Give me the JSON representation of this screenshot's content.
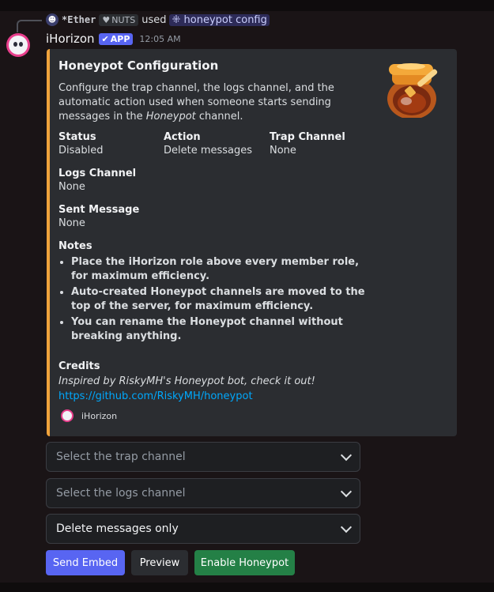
{
  "reply": {
    "user": "*Ether",
    "tag": "NUTS",
    "used": "used",
    "command": "honeypot config"
  },
  "message": {
    "bot_name": "iHorizon",
    "app_badge": "APP",
    "time": "12:05 AM"
  },
  "embed": {
    "accent_color": "#f0a33c",
    "title": "Honeypot Configuration",
    "desc_before": "Configure the trap channel, the logs channel, and the automatic action used when someone starts sending messages in the ",
    "desc_italic": "Honeypot",
    "desc_after": " channel.",
    "thumbnail_icon": "honey-pot-icon",
    "fields": {
      "status": {
        "name": "Status",
        "value": "Disabled"
      },
      "action": {
        "name": "Action",
        "value": "Delete messages"
      },
      "trap": {
        "name": "Trap Channel",
        "value": "None"
      },
      "logs": {
        "name": "Logs Channel",
        "value": "None"
      },
      "sent": {
        "name": "Sent Message",
        "value": "None"
      }
    },
    "notes": {
      "name": "Notes",
      "items": [
        "Place the iHorizon role above every member role, for maximum efficiency.",
        "Auto-created Honeypot channels are moved to the top of the server, for maximum efficiency.",
        "You can rename the Honeypot channel without breaking anything."
      ]
    },
    "credits": {
      "name": "Credits",
      "text": "Inspired by RiskyMH's Honeypot bot, check it out!",
      "link": "https://github.com/RiskyMH/honeypot"
    },
    "footer": "iHorizon"
  },
  "selects": {
    "trap_placeholder": "Select the trap channel",
    "logs_placeholder": "Select the logs channel",
    "action_value": "Delete messages only"
  },
  "buttons": {
    "send_embed": "Send Embed",
    "preview": "Preview",
    "enable": "Enable Honeypot"
  }
}
